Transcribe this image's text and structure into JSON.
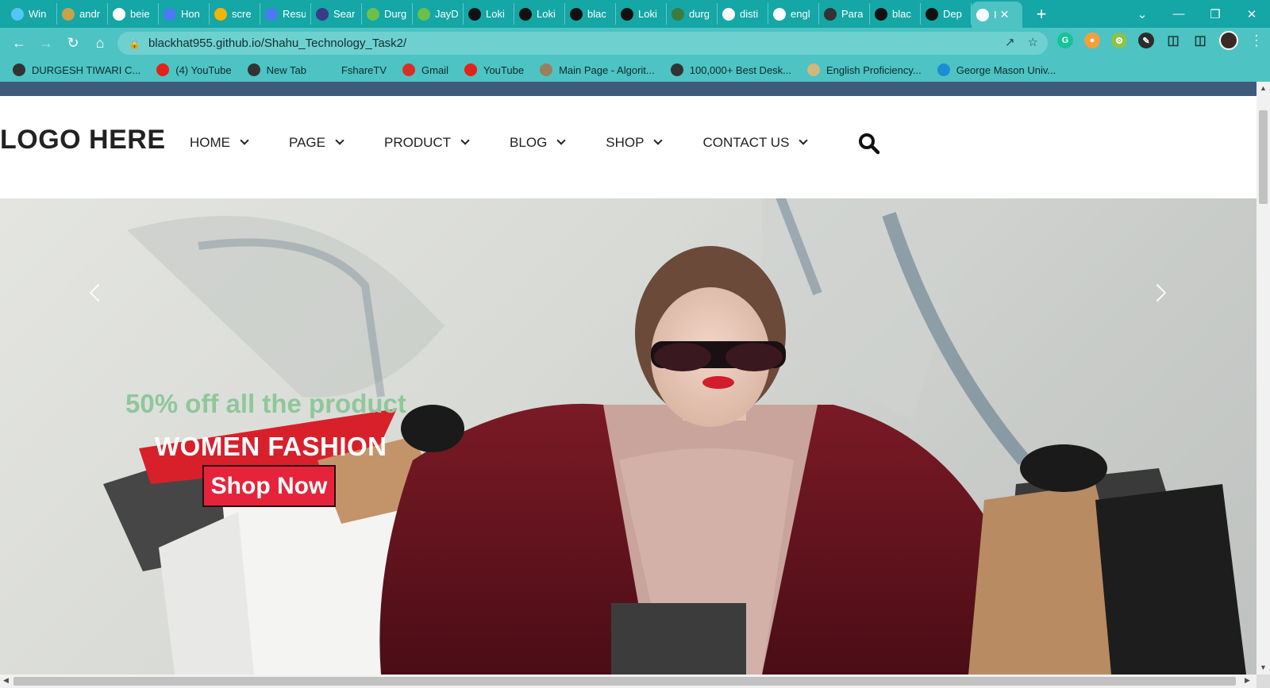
{
  "browser": {
    "tabs": [
      {
        "title": "Win",
        "icon": "flutter-icon",
        "color": "#54c5f8"
      },
      {
        "title": "andr",
        "icon": "android-icon",
        "color": "#c8a24a"
      },
      {
        "title": "beie",
        "icon": "google-icon",
        "color": "#ffffff"
      },
      {
        "title": "Hon",
        "icon": "docs-icon",
        "color": "#4a7bf0"
      },
      {
        "title": "scre",
        "icon": "drive-icon",
        "color": "#f5b400"
      },
      {
        "title": "Resu",
        "icon": "docs-icon",
        "color": "#4a7bf0"
      },
      {
        "title": "Sear",
        "icon": "search-engine-icon",
        "color": "#3a3a8a"
      },
      {
        "title": "Durg",
        "icon": "leaf-icon",
        "color": "#6cc04a"
      },
      {
        "title": "JayD",
        "icon": "leaf-icon",
        "color": "#6cc04a"
      },
      {
        "title": "Loki",
        "icon": "github-icon",
        "color": "#111111"
      },
      {
        "title": "Loki",
        "icon": "github-icon",
        "color": "#111111"
      },
      {
        "title": "blac",
        "icon": "github-icon",
        "color": "#111111"
      },
      {
        "title": "Loki",
        "icon": "github-icon",
        "color": "#111111"
      },
      {
        "title": "durg",
        "icon": "leaf-icon",
        "color": "#3b7d3b"
      },
      {
        "title": "disti",
        "icon": "google-icon",
        "color": "#ffffff"
      },
      {
        "title": "engl",
        "icon": "google-icon",
        "color": "#ffffff"
      },
      {
        "title": "Para",
        "icon": "quill-icon",
        "color": "#333333"
      },
      {
        "title": "blac",
        "icon": "github-icon",
        "color": "#111111"
      },
      {
        "title": "Dep",
        "icon": "github-icon",
        "color": "#111111"
      },
      {
        "title": "I",
        "icon": "globe-icon",
        "color": "#ffffff",
        "active": true
      }
    ],
    "new_tab": "+",
    "window_controls": {
      "dropdown": "⌄",
      "minimize": "—",
      "restore": "❐",
      "close": "✕"
    },
    "url": "blackhat955.github.io/Shahu_Technology_Task2/",
    "bookmarks": [
      {
        "label": "DURGESH TIWARI C...",
        "icon": "globe-icon",
        "color": "#333333"
      },
      {
        "label": "(4) YouTube",
        "icon": "youtube-icon",
        "color": "#e62117"
      },
      {
        "label": "New Tab",
        "icon": "globe-icon",
        "color": "#333333"
      },
      {
        "label": "FshareTV",
        "icon": "fshare-icon",
        "color": "#4dc3c3"
      },
      {
        "label": "Gmail",
        "icon": "gmail-icon",
        "color": "#d93025"
      },
      {
        "label": "YouTube",
        "icon": "youtube-icon",
        "color": "#e62117"
      },
      {
        "label": "Main Page - Algorit...",
        "icon": "algorithm-icon",
        "color": "#9a7f5f"
      },
      {
        "label": "100,000+ Best Desk...",
        "icon": "globe-icon",
        "color": "#333333"
      },
      {
        "label": "English Proficiency...",
        "icon": "cu-icon",
        "color": "#cfb87c"
      },
      {
        "label": "George Mason Univ...",
        "icon": "salesforce-icon",
        "color": "#1a8fd6"
      }
    ]
  },
  "site": {
    "logo": "LOGO HERE",
    "nav": [
      "HOME",
      "PAGE",
      "PRODUCT",
      "BLOG",
      "SHOP",
      "CONTACT US"
    ],
    "hero": {
      "promo": "50% off all the product",
      "headline": "WOMEN FASHION",
      "cta": "Shop Now"
    }
  },
  "colors": {
    "tabstrip": "#15a6a6",
    "toolbar": "#4dc3c3",
    "cta": "#e5243b",
    "promo": "#8fc79a"
  }
}
